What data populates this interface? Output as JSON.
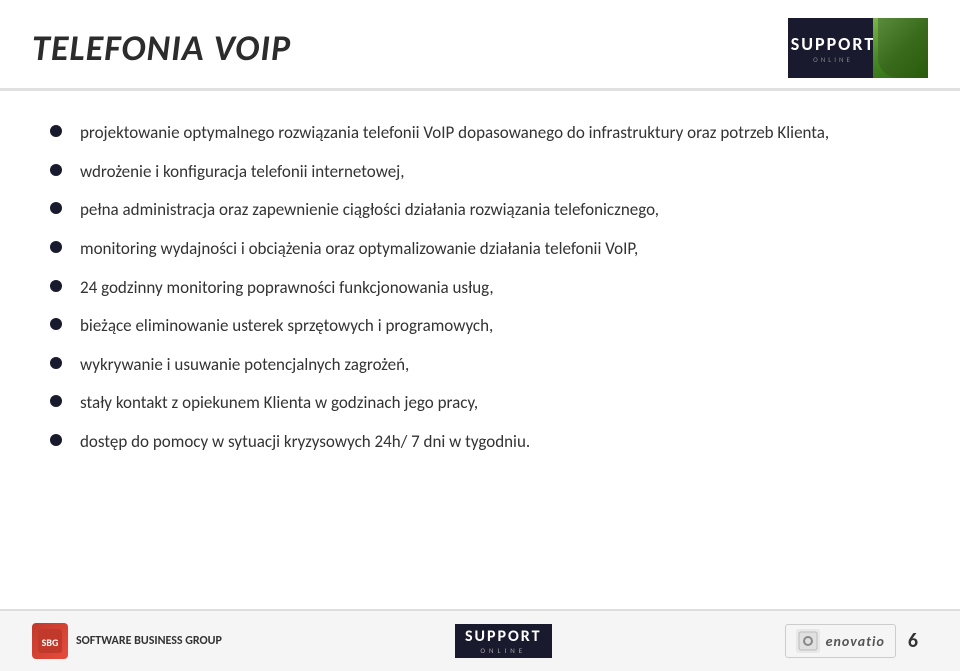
{
  "header": {
    "title": "TELEFONIA VoIP",
    "logo_support": "SUPPORT",
    "logo_online": "ONLINE"
  },
  "bullets": [
    {
      "id": 1,
      "text": "projektowanie optymalnego rozwiązania telefonii VoIP dopasowanego do infrastruktury oraz potrzeb Klienta,"
    },
    {
      "id": 2,
      "text": "wdrożenie i konfiguracja telefonii internetowej,"
    },
    {
      "id": 3,
      "text": "pełna administracja oraz zapewnienie ciągłości działania rozwiązania telefonicznego,"
    },
    {
      "id": 4,
      "text": "monitoring wydajności i obciążenia oraz optymalizowanie działania telefonii VoIP,"
    },
    {
      "id": 5,
      "text": "24 godzinny monitoring poprawności funkcjonowania usług,"
    },
    {
      "id": 6,
      "text": "bieżące eliminowanie usterek sprzętowych i programowych,"
    },
    {
      "id": 7,
      "text": "wykrywanie i usuwanie potencjalnych zagrożeń,"
    },
    {
      "id": 8,
      "text": "stały kontakt  z opiekunem Klienta w godzinach jego pracy,"
    },
    {
      "id": 9,
      "text": "dostęp do pomocy w sytuacji kryzysowych 24h/ 7 dni w tygodniu."
    }
  ],
  "footer": {
    "sbg_label": "Software Business Group",
    "support_label": "SUPPORT",
    "online_label": "ONLINE",
    "enovatio_label": "enovatio",
    "page_number": "6"
  }
}
